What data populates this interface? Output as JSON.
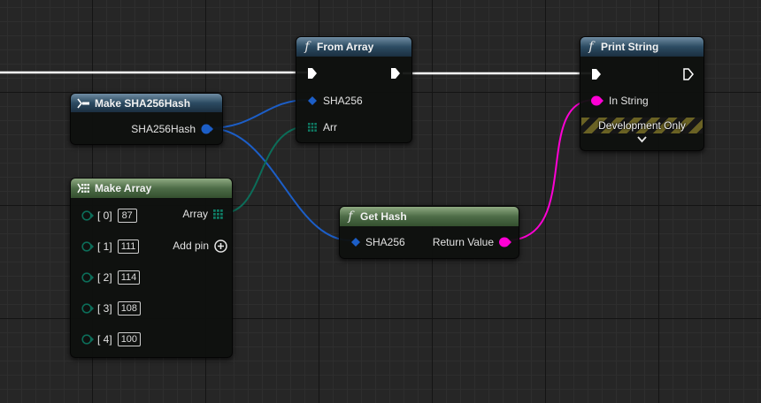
{
  "nodes": {
    "from_array": {
      "title": "From Array",
      "pin_sha": "SHA256",
      "pin_arr": "Arr"
    },
    "print_string": {
      "title": "Print String",
      "pin_in": "In String",
      "dev_label": "Development Only"
    },
    "make_hash": {
      "title": "Make SHA256Hash",
      "pin_out": "SHA256Hash"
    },
    "make_array": {
      "title": "Make Array",
      "out_label": "Array",
      "add_pin": "Add pin",
      "items": [
        {
          "index": "[ 0]",
          "value": "87"
        },
        {
          "index": "[ 1]",
          "value": "111"
        },
        {
          "index": "[ 2]",
          "value": "114"
        },
        {
          "index": "[ 3]",
          "value": "108"
        },
        {
          "index": "[ 4]",
          "value": "100"
        }
      ]
    },
    "get_hash": {
      "title": "Get Hash",
      "pin_sha": "SHA256",
      "pin_ret": "Return Value"
    }
  },
  "colors": {
    "exec": "#ffffff",
    "struct": "#1c5ec7",
    "byte": "#0c6d59",
    "string": "#ff00d5",
    "function_header": "#2c4b62",
    "pure_header": "#4d6c47"
  },
  "icons": {
    "function": "f",
    "exec_pin": "exec-arrow",
    "struct_pin": "diamond",
    "array_pin": "grid",
    "add_pin": "circle-plus",
    "expand": "chevron-down"
  }
}
